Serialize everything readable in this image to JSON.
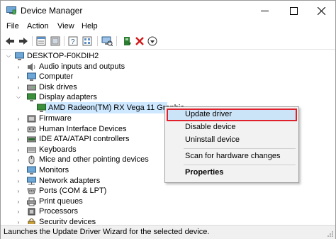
{
  "window": {
    "title": "Device Manager",
    "controls": [
      "minimize",
      "maximize",
      "close"
    ]
  },
  "menu": [
    "File",
    "Action",
    "View",
    "Help"
  ],
  "toolbar": {
    "icons": [
      "back-arrow-icon",
      "forward-arrow-icon",
      "properties-icon",
      "help-icon",
      "show-hidden-icon",
      "update-driver-icon",
      "scan-hardware-icon",
      "add-driver-icon",
      "uninstall-icon",
      "disable-icon"
    ]
  },
  "tree": {
    "root": "DESKTOP-F0KDIH2",
    "items": [
      {
        "label": "Audio inputs and outputs",
        "expanded": false,
        "icon": "speaker-icon"
      },
      {
        "label": "Computer",
        "expanded": false,
        "icon": "computer-icon"
      },
      {
        "label": "Disk drives",
        "expanded": false,
        "icon": "disk-drive-icon"
      },
      {
        "label": "Display adapters",
        "expanded": true,
        "icon": "display-adapter-icon"
      },
      {
        "label": "AMD Radeon(TM) RX Vega 11 Graphic",
        "child": true,
        "selected": true,
        "icon": "display-adapter-icon"
      },
      {
        "label": "Firmware",
        "expanded": false,
        "icon": "firmware-icon"
      },
      {
        "label": "Human Interface Devices",
        "expanded": false,
        "icon": "hid-icon"
      },
      {
        "label": "IDE ATA/ATAPI controllers",
        "expanded": false,
        "icon": "ide-controller-icon"
      },
      {
        "label": "Keyboards",
        "expanded": false,
        "icon": "keyboard-icon"
      },
      {
        "label": "Mice and other pointing devices",
        "expanded": false,
        "icon": "mouse-icon"
      },
      {
        "label": "Monitors",
        "expanded": false,
        "icon": "monitor-icon"
      },
      {
        "label": "Network adapters",
        "expanded": false,
        "icon": "network-adapter-icon"
      },
      {
        "label": "Ports (COM & LPT)",
        "expanded": false,
        "icon": "port-icon"
      },
      {
        "label": "Print queues",
        "expanded": false,
        "icon": "printer-icon"
      },
      {
        "label": "Processors",
        "expanded": false,
        "icon": "processor-icon"
      },
      {
        "label": "Security devices",
        "expanded": false,
        "icon": "security-device-icon"
      }
    ]
  },
  "context_menu": {
    "items": [
      "Update driver",
      "Disable device",
      "Uninstall device",
      "Scan for hardware changes",
      "Properties"
    ],
    "highlighted": "Update driver",
    "highlight_border_color": "#e0212b"
  },
  "status": {
    "text": "Launches the Update Driver Wizard for the selected device."
  },
  "colors": {
    "selection": "#cde8ff",
    "menu_highlight": "#cce4f7"
  }
}
